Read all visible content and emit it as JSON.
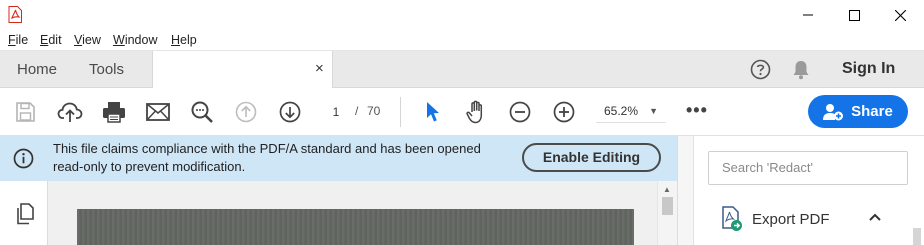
{
  "window": {
    "menu": [
      "File",
      "Edit",
      "View",
      "Window",
      "Help"
    ]
  },
  "tabs": {
    "home": "Home",
    "tools": "Tools",
    "close_glyph": "×"
  },
  "header": {
    "signin": "Sign In"
  },
  "toolbar": {
    "page_current": "1",
    "page_separator": "/",
    "page_total": "70",
    "zoom": "65.2%",
    "more": "•••",
    "share_label": "Share"
  },
  "infobar": {
    "message": "This file claims compliance with the PDF/A standard and has been opened read-only to prevent modification.",
    "enable_label": "Enable Editing"
  },
  "rightpanel": {
    "search_placeholder": "Search 'Redact'",
    "export_label": "Export PDF"
  },
  "colors": {
    "accent": "#1473e6",
    "infobar": "#cfe6f7",
    "select_tool": "#1473e6"
  },
  "icons": [
    "acrobat-icon",
    "minimize-icon",
    "maximize-icon",
    "close-icon",
    "help-icon",
    "bell-icon",
    "save-icon",
    "upload-cloud-icon",
    "print-icon",
    "mail-icon",
    "search-zoom-icon",
    "prev-page-icon",
    "next-page-icon",
    "select-arrow-icon",
    "hand-icon",
    "zoom-out-icon",
    "zoom-in-icon",
    "share-user-icon",
    "info-icon",
    "pages-icon",
    "export-pdf-icon",
    "chevron-up-icon"
  ]
}
